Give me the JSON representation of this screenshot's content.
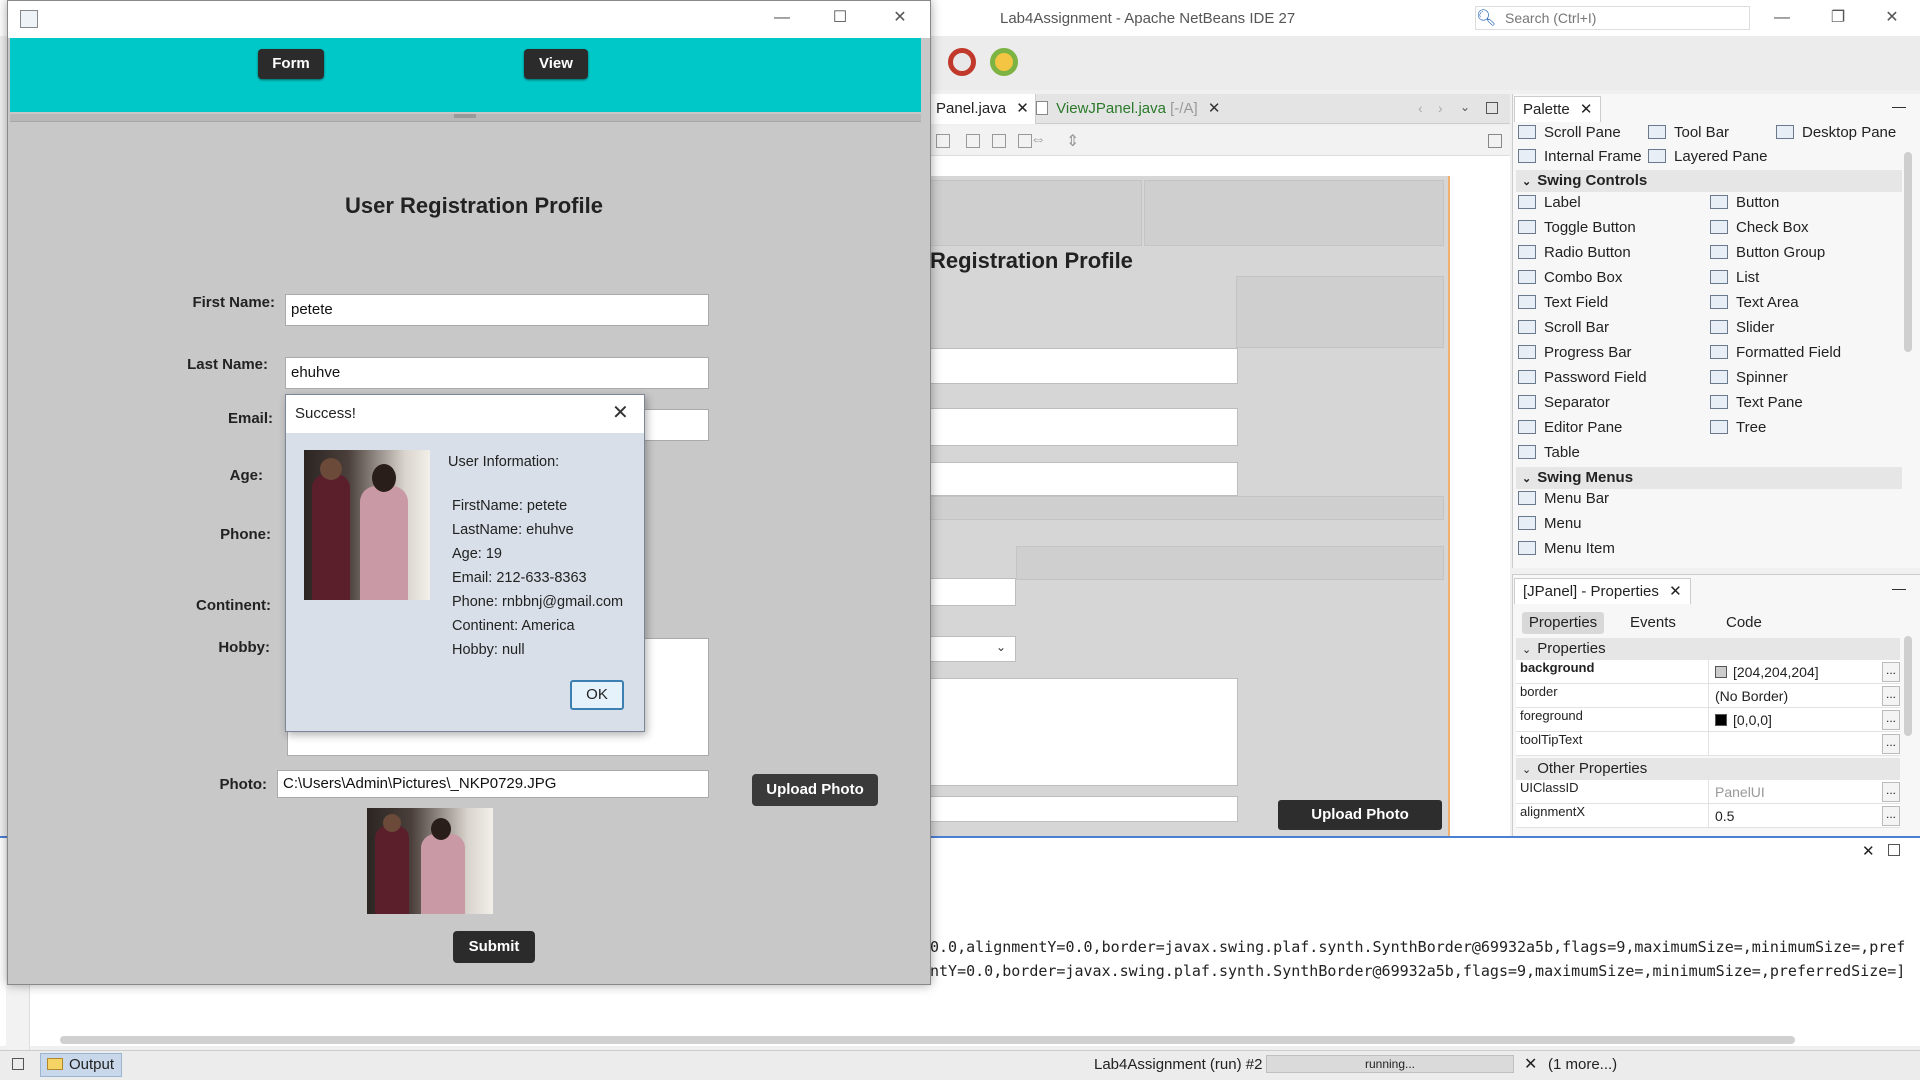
{
  "ide": {
    "title": "Lab4Assignment - Apache NetBeans IDE 27",
    "search_placeholder": "Search (Ctrl+I)",
    "editor_tabs": [
      {
        "label": "Panel.java"
      },
      {
        "label": "ViewJPanel.java",
        "suffix": "[-/A]"
      }
    ],
    "design": {
      "title": "Registration Profile",
      "upload_label": "Upload Photo"
    },
    "palette": {
      "tab": "Palette",
      "top_items": [
        "Scroll Pane",
        "Tool Bar",
        "Desktop Pane",
        "Internal Frame",
        "Layered Pane"
      ],
      "swing_controls_label": "Swing Controls",
      "swing_controls": [
        [
          "Label",
          "Button"
        ],
        [
          "Toggle Button",
          "Check Box"
        ],
        [
          "Radio Button",
          "Button Group"
        ],
        [
          "Combo Box",
          "List"
        ],
        [
          "Text Field",
          "Text Area"
        ],
        [
          "Scroll Bar",
          "Slider"
        ],
        [
          "Progress Bar",
          "Formatted Field"
        ],
        [
          "Password Field",
          "Spinner"
        ],
        [
          "Separator",
          "Text Pane"
        ],
        [
          "Editor Pane",
          "Tree"
        ],
        [
          "Table",
          ""
        ]
      ],
      "swing_menus_label": "Swing Menus",
      "swing_menus": [
        "Menu Bar",
        "Menu",
        "Menu Item"
      ]
    },
    "properties": {
      "tab": "[JPanel] - Properties",
      "subtabs": [
        "Properties",
        "Events",
        "Code"
      ],
      "section_properties": "Properties",
      "rows": [
        {
          "name": "background",
          "value": "[204,204,204]",
          "swatch": "#cccccc"
        },
        {
          "name": "border",
          "value": "(No Border)"
        },
        {
          "name": "foreground",
          "value": "[0,0,0]",
          "swatch": "#000000"
        },
        {
          "name": "toolTipText",
          "value": ""
        }
      ],
      "section_other": "Other Properties",
      "other_rows": [
        {
          "name": "UIClassID",
          "value": "PanelUI"
        },
        {
          "name": "alignmentX",
          "value": "0.5"
        }
      ]
    },
    "output": {
      "lines": [
        "0.0,alignmentY=0.0,border=javax.swing.plaf.synth.SynthBorder@69932a5b,flags=9,maximumSize=,minimumSize=,pref",
        "ntY=0.0,border=javax.swing.plaf.synth.SynthBorder@69932a5b,flags=9,maximumSize=,minimumSize=,preferredSize=]"
      ]
    },
    "status": {
      "output_tab": "Output",
      "run_label": "Lab4Assignment (run) #2",
      "run_state": "running...",
      "more": "(1 more...)"
    }
  },
  "app": {
    "nav": {
      "form_label": "Form",
      "view_label": "View"
    },
    "form_title": "User Registration Profile",
    "labels": {
      "first_name": "First Name:",
      "last_name": "Last Name:",
      "email": "Email:",
      "age": "Age:",
      "phone": "Phone:",
      "continent": "Continent:",
      "hobby": "Hobby:",
      "photo": "Photo:"
    },
    "values": {
      "first_name": "petete",
      "last_name": "ehuhve",
      "photo_path": "C:\\Users\\Admin\\Pictures\\_NKP0729.JPG"
    },
    "upload_label": "Upload Photo",
    "submit_label": "Submit"
  },
  "dialog": {
    "title": "Success!",
    "heading": "User Information:",
    "lines": [
      "FirstName: petete",
      "LastName: ehuhve",
      "Age: 19",
      "Email: 212-633-8363",
      "Phone: rnbbnj@gmail.com",
      "Continent: America",
      "Hobby: null"
    ],
    "ok_label": "OK"
  },
  "colors": {
    "header_accent": "#00c8c8",
    "ide_progress_accent": "#4a7fd4"
  }
}
